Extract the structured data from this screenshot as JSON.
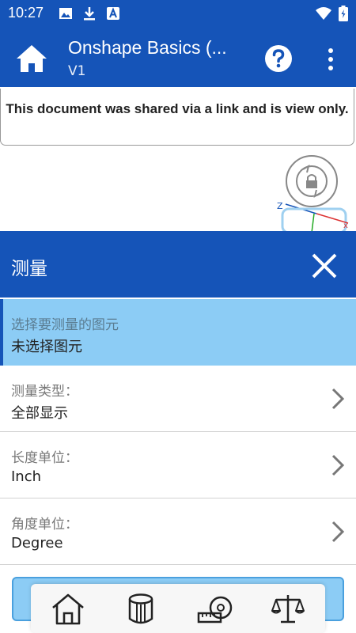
{
  "status_bar": {
    "time": "10:27",
    "icons": [
      "image-icon",
      "download-icon",
      "app-notification-icon",
      "wifi-icon",
      "battery-icon"
    ]
  },
  "app_bar": {
    "title": "Onshape Basics (...",
    "version": "V1",
    "icons": [
      "home-icon",
      "help-icon",
      "more-vert-icon"
    ]
  },
  "banner": {
    "text": "This document was shared via a link and is view only."
  },
  "viewport": {
    "icons": [
      "rotate-lock-icon",
      "view-cube-icon"
    ],
    "axis_label": "Z"
  },
  "measure_panel": {
    "title": "测量",
    "rows": [
      {
        "label": "选择要测量的图元",
        "value": "未选择图元"
      },
      {
        "label": "测量类型：",
        "value": "全部显示"
      },
      {
        "label": "长度单位：",
        "value": "Inch"
      },
      {
        "label": "角度单位：",
        "value": "Degree"
      }
    ]
  },
  "toolbar": {
    "tools": [
      "house-view-icon",
      "cylinder-part-icon",
      "tape-measure-icon",
      "balance-scale-icon"
    ]
  },
  "colors": {
    "primary": "#1554b8",
    "selected": "#8cccf5",
    "accent_border": "#4aa0de"
  }
}
